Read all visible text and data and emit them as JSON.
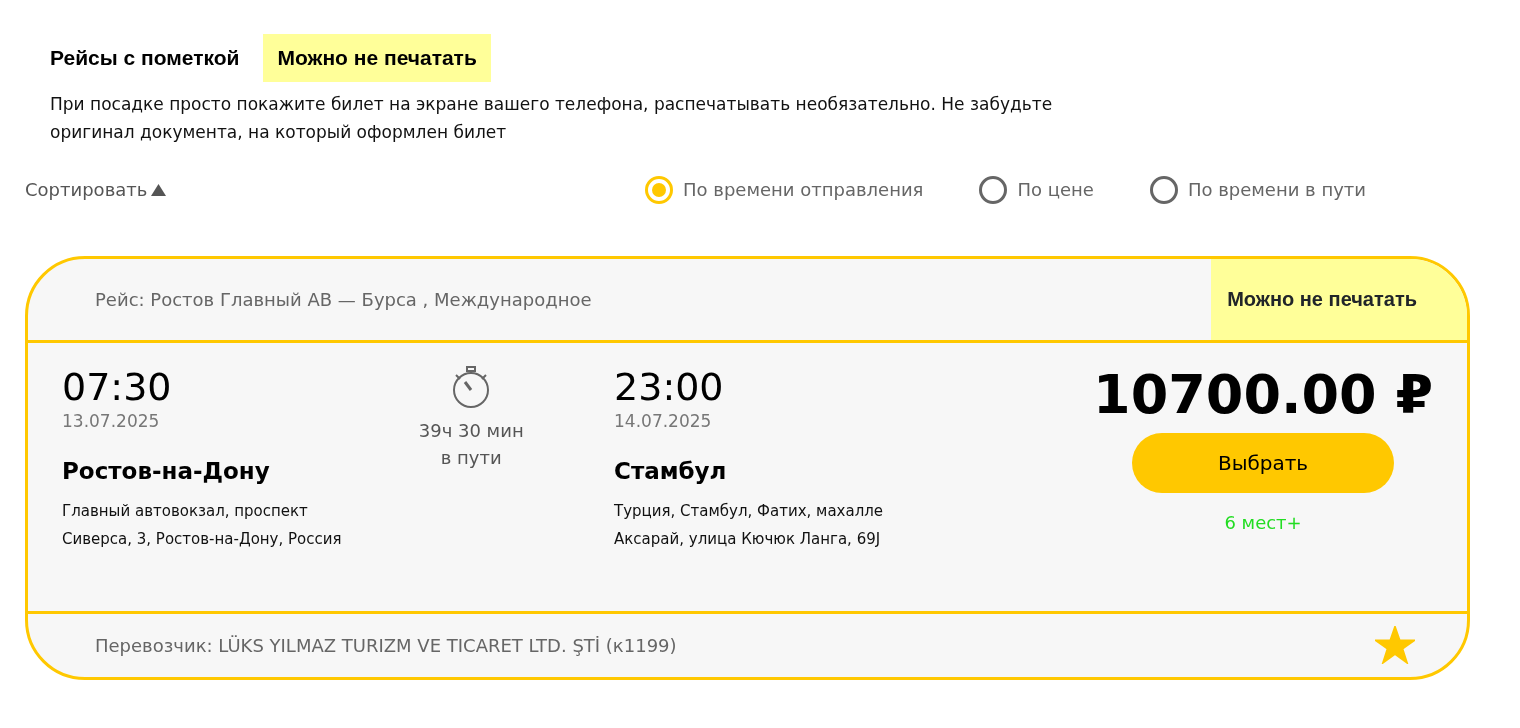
{
  "notice": {
    "title": "Рейсы с пометкой",
    "badge": "Можно не печатать",
    "text": "При посадке просто покажите билет на экране вашего телефона, распечатывать необязательно. Не забудьте оригинал документа, на который оформлен билет"
  },
  "sort": {
    "label": "Сортировать",
    "ascending": true,
    "options": [
      {
        "label": "По времени отправления",
        "selected": true
      },
      {
        "label": "По цене",
        "selected": false
      },
      {
        "label": "По времени в пути",
        "selected": false
      }
    ]
  },
  "trips": [
    {
      "route": "Рейс: Ростов Главный АВ — Бурса , Международное",
      "badge": "Можно не печатать",
      "departure": {
        "time": "07:30",
        "date": "13.07.2025",
        "city": "Ростов-на-Дону",
        "address": [
          "Главный автовокзал, проспект",
          "Сиверса, 3, Ростов-на-Дону, Россия"
        ]
      },
      "duration": [
        "39ч 30 мин",
        "в пути"
      ],
      "arrival": {
        "time": "23:00",
        "date": "14.07.2025",
        "city": "Стамбул",
        "address": [
          "Турция, Стамбул, Фатих, махалле",
          "Аксарай, улица Кючюк Ланга, 69J"
        ]
      },
      "price": "10700.00 ₽",
      "button": "Выбрать",
      "seats": "6 мест+",
      "carrier": "Перевозчик: LÜKS YILMAZ TURIZM VE TICARET LTD. ŞTİ (к1199)",
      "favorite": true
    }
  ]
}
